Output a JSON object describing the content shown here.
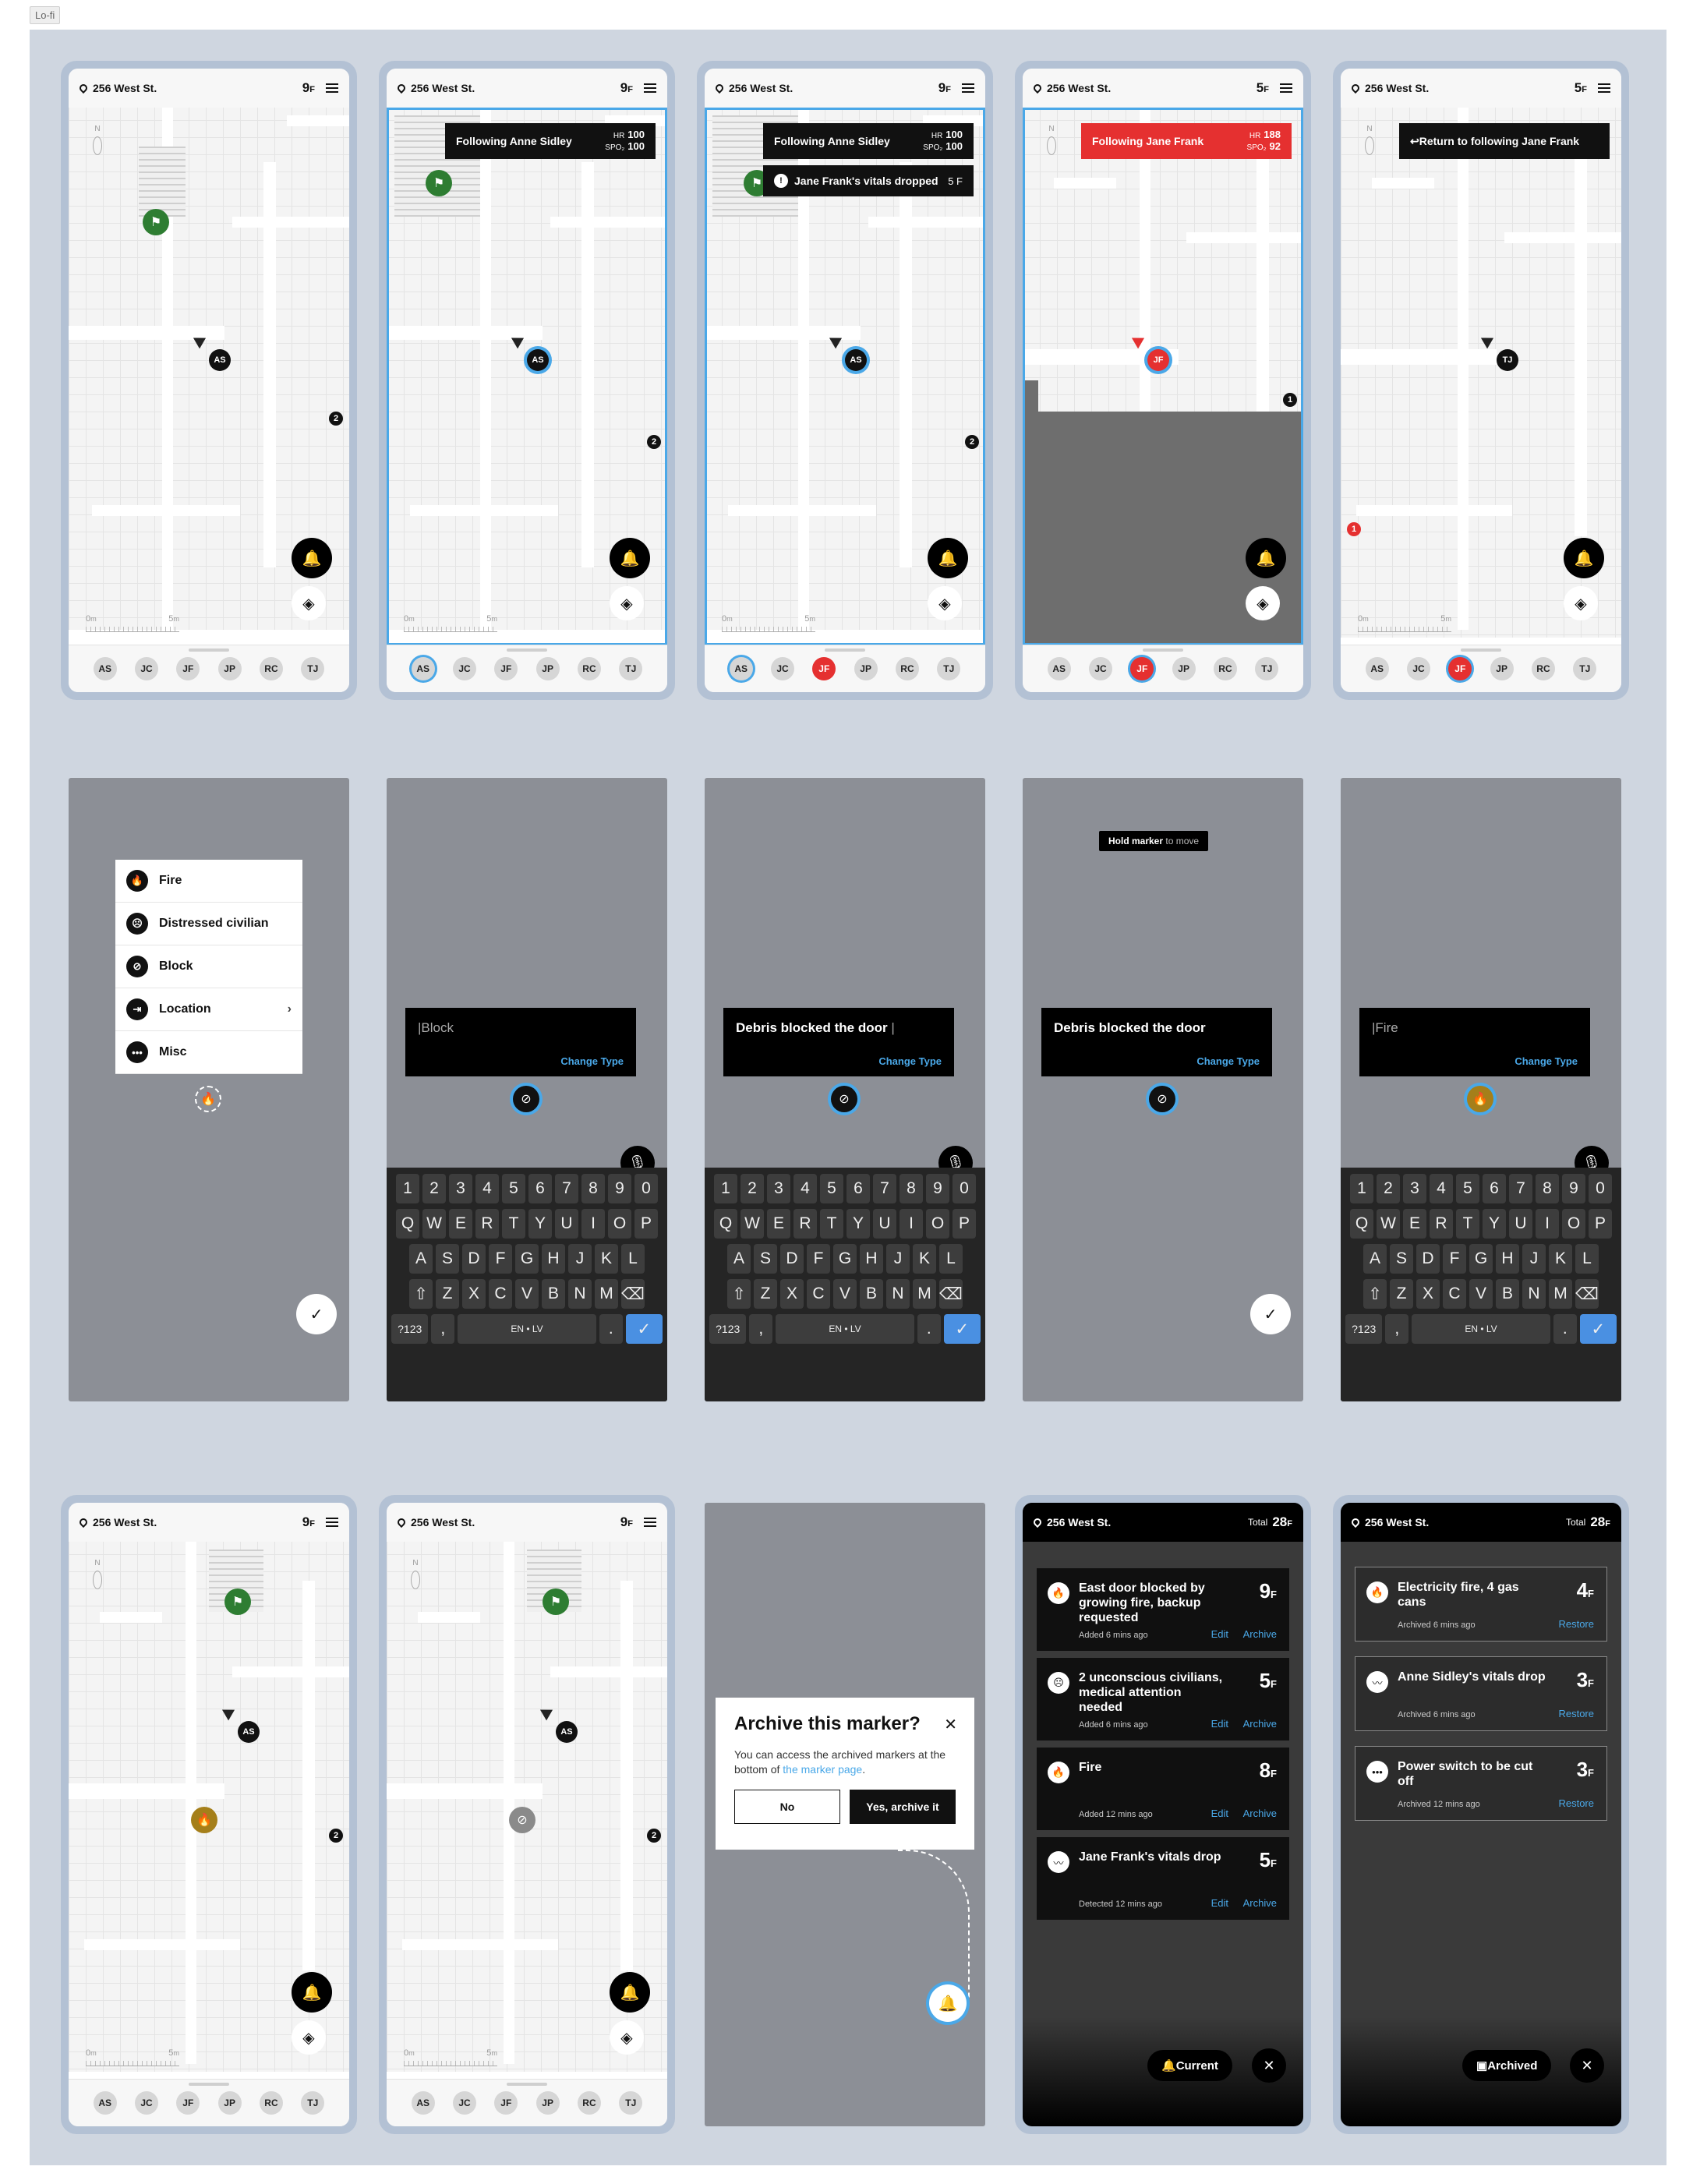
{
  "frame_label": "Lo-fi",
  "header": {
    "address": "256 West St.",
    "floor_unit": "F",
    "total_label": "Total",
    "total_floors": "28"
  },
  "people": [
    "AS",
    "JC",
    "JF",
    "JP",
    "RC",
    "TJ"
  ],
  "row1": [
    {
      "floor": "9",
      "focus": "AS",
      "badge": "2"
    },
    {
      "floor": "9",
      "focus": "AS",
      "badge": "2",
      "toast": {
        "label": "Following Anne Sidley",
        "hr_label": "HR",
        "hr": "100",
        "spo2_label": "SPO₂",
        "spo2": "100"
      }
    },
    {
      "floor": "9",
      "focus": "AS",
      "badge": "2",
      "toast": {
        "label": "Following Anne Sidley",
        "hr_label": "HR",
        "hr": "100",
        "spo2_label": "SPO₂",
        "spo2": "100"
      },
      "alert": {
        "label": "Jane Frank's vitals dropped",
        "floor": "5 F"
      }
    },
    {
      "floor": "5",
      "focus": "JF",
      "badge": "1",
      "toast": {
        "label": "Following Jane Frank",
        "hr_label": "HR",
        "hr": "188",
        "spo2_label": "SPO₂",
        "spo2": "92"
      }
    },
    {
      "floor": "5",
      "focus": "TJ",
      "badge": "1",
      "return_label": "Return to following Jane Frank"
    }
  ],
  "scale": {
    "zero": "0",
    "five": "5",
    "unit": "m"
  },
  "compass_n": "N",
  "marker_types": [
    {
      "label": "Fire",
      "icon": "fire-icon"
    },
    {
      "label": "Distressed civilian",
      "icon": "civilian-icon"
    },
    {
      "label": "Block",
      "icon": "block-icon"
    },
    {
      "label": "Location",
      "icon": "location-icon"
    },
    {
      "label": "Misc",
      "icon": "misc-icon"
    }
  ],
  "notes": {
    "block_placeholder": "|Block",
    "typed": "Debris blocked the door",
    "typed_cursor": " |",
    "fire_placeholder": "|Fire",
    "change_type": "Change Type"
  },
  "hint": {
    "bold": "Hold marker",
    "rest": " to move"
  },
  "keyboard": {
    "row1": [
      "1",
      "2",
      "3",
      "4",
      "5",
      "6",
      "7",
      "8",
      "9",
      "0"
    ],
    "row2": [
      "Q",
      "W",
      "E",
      "R",
      "T",
      "Y",
      "U",
      "I",
      "O",
      "P"
    ],
    "row3": [
      "A",
      "S",
      "D",
      "F",
      "G",
      "H",
      "J",
      "K",
      "L"
    ],
    "row4": [
      "Z",
      "X",
      "C",
      "V",
      "B",
      "N",
      "M"
    ],
    "sym": "?123",
    "comma": ",",
    "lang": "EN • LV",
    "dot": "."
  },
  "dialog": {
    "title": "Archive this marker?",
    "body_before": "You can access the archived markers at the bottom of ",
    "link": "the marker page",
    "body_after": ".",
    "no": "No",
    "yes": "Yes, archive it"
  },
  "current": [
    {
      "title": "East door blocked by growing fire, backup requested",
      "floor": "9",
      "meta": "Added 6 mins ago",
      "icon": "fire-icon"
    },
    {
      "title": "2 unconscious civilians, medical attention needed",
      "floor": "5",
      "meta": "Added 6 mins ago",
      "icon": "civilian-icon"
    },
    {
      "title": "Fire",
      "floor": "8",
      "meta": "Added 12 mins ago",
      "icon": "fire-icon"
    },
    {
      "title": "Jane Frank's vitals drop",
      "floor": "5",
      "meta": "Detected 12 mins ago",
      "icon": "pulse-icon"
    }
  ],
  "archived": [
    {
      "title": "Electricity fire, 4 gas cans",
      "floor": "4",
      "meta": "Archived 6 mins ago",
      "icon": "fire-icon"
    },
    {
      "title": "Anne Sidley's vitals drop",
      "floor": "3",
      "meta": "Archived 6 mins ago",
      "icon": "pulse-icon"
    },
    {
      "title": "Power switch to be cut off",
      "floor": "3",
      "meta": "Archived 12 mins ago",
      "icon": "misc-icon"
    }
  ],
  "actions": {
    "edit": "Edit",
    "archive": "Archive",
    "restore": "Restore",
    "current": "Current",
    "archived": "Archived"
  },
  "colors": {
    "accent": "#4aa8e8",
    "alert": "#e53030",
    "exit": "#2e7d32",
    "backdrop": "#8c8f96"
  }
}
